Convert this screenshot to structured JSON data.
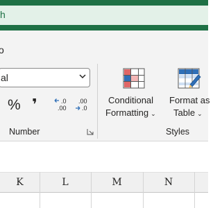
{
  "title_bar": {
    "text": "h"
  },
  "ribbon_tabs": {
    "partial_tab": "o"
  },
  "number_group": {
    "format_value": "al",
    "percent_symbol": "%",
    "comma_symbol": "❜",
    "increase_decimal_top": ".0",
    "increase_decimal_bottom": ".00",
    "decrease_decimal_top": ".00",
    "decrease_decimal_bottom": ".0",
    "label": "Number"
  },
  "styles_group": {
    "conditional_formatting_line1": "Conditional",
    "conditional_formatting_line2": "Formatting",
    "format_as_table_line1": "Format as",
    "format_as_table_line2": "Table",
    "dropdown_caret": "⌄",
    "label": "Styles"
  },
  "columns": [
    "K",
    "L",
    "M",
    "N"
  ],
  "colors": {
    "title_green": "#1e7145",
    "ribbon_bg": "#f3f3f3",
    "accent_red": "#e06666",
    "accent_blue": "#2f6fb7"
  }
}
